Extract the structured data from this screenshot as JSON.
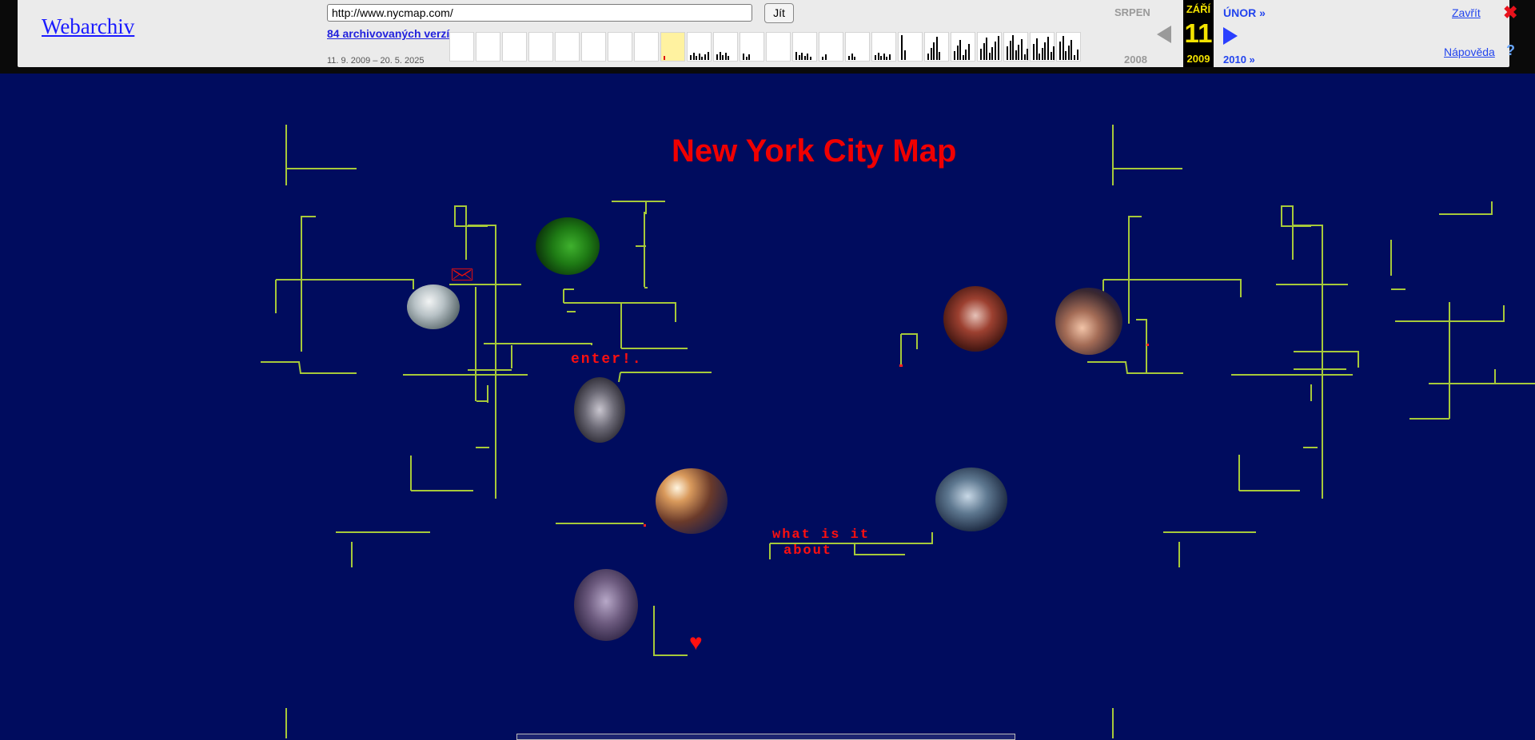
{
  "toolbar": {
    "logo": "Webarchiv",
    "url_value": "http://www.nycmap.com/",
    "go_label": "Jít",
    "versions_label": "84 archivovaných verzí",
    "date_range": "11. 9. 2009 – 20. 5. 2025",
    "prev_month": "SRPEN",
    "prev_year": "2008",
    "current_month": "ZÁŘÍ",
    "current_day": "11",
    "current_year": "2009",
    "next_month": "ÚNOR »",
    "next_year": "2010 »",
    "close_label": "Zavřít",
    "help_label": "Nápověda",
    "close_icon_glyph": "✖",
    "help_icon_glyph": "?",
    "timeline_captures": [
      0,
      0,
      0,
      0,
      0,
      0,
      0,
      0,
      1,
      7,
      5,
      3,
      0,
      6,
      2,
      3,
      6,
      2,
      5,
      6,
      7,
      8,
      8,
      7
    ],
    "timeline_highlight_index": 8
  },
  "page": {
    "title": "New York City Map",
    "enter_link": "enter!.",
    "about_line1": "what is it",
    "about_line2": "about",
    "heart_glyph": "♥",
    "colors": {
      "background": "#000c5e",
      "title": "#f00000",
      "grid_line": "#a6c93a"
    }
  }
}
